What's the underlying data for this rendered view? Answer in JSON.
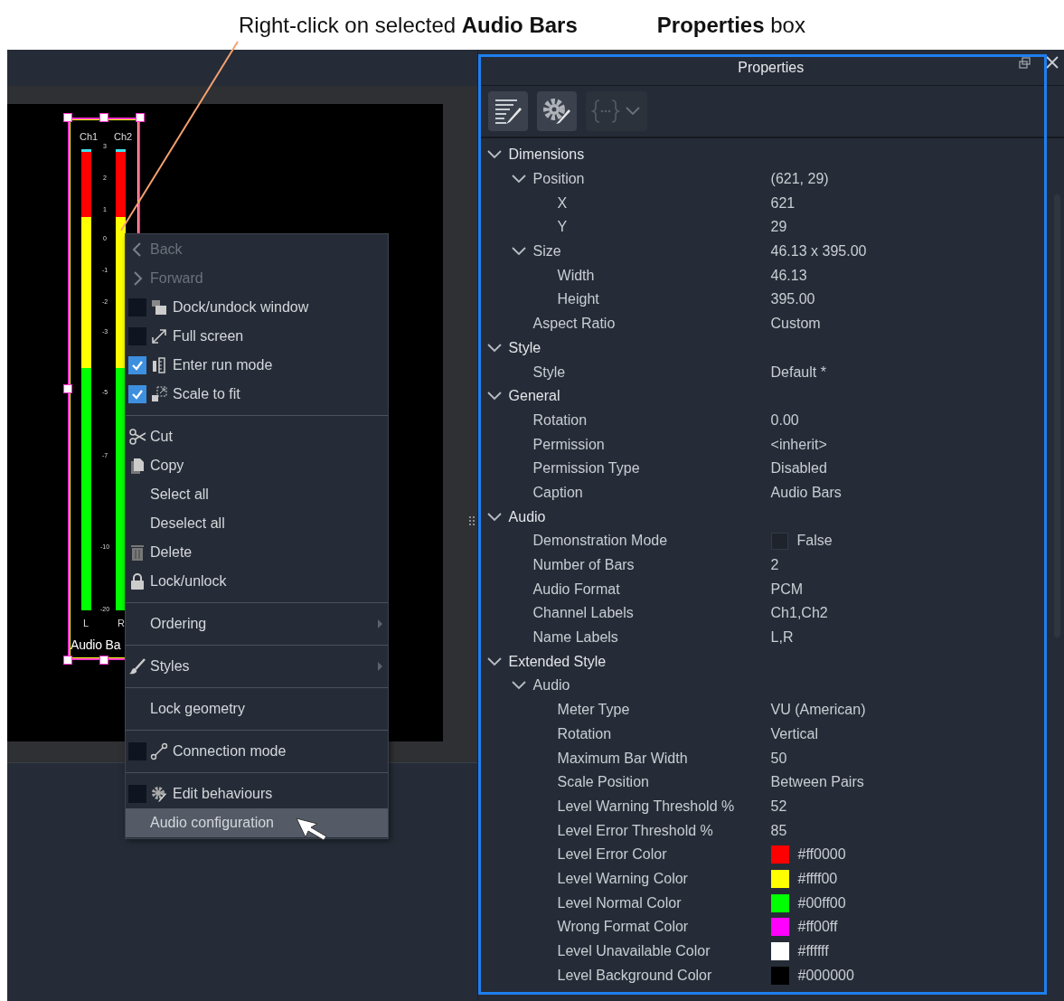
{
  "annotations": [
    {
      "text": "Right-click on selected **Audio Bars**"
    },
    {
      "text": "**Properties** box"
    }
  ],
  "audio_widget": {
    "channel_labels": [
      "Ch1",
      "Ch2"
    ],
    "scale_labels": [
      "3",
      "2",
      "1",
      "0",
      "-1",
      "-2",
      "-3",
      "-5",
      "-7",
      "-10",
      "-20"
    ],
    "name_labels": [
      "L",
      "R"
    ],
    "caption": "Audio Ba",
    "selected": true
  },
  "context_menu": {
    "sections": [
      [
        {
          "label": "Back",
          "kind": "nav",
          "disabled": true,
          "selected": false
        },
        {
          "label": "Forward",
          "kind": "nav",
          "disabled": true,
          "selected": false
        },
        {
          "label": "Dock/undock window",
          "kind": "check",
          "checked": false,
          "disabled": false,
          "selected": false
        },
        {
          "label": "Full screen",
          "kind": "check",
          "checked": false,
          "disabled": false,
          "selected": false
        },
        {
          "label": "Enter run mode",
          "kind": "check",
          "checked": true,
          "disabled": false,
          "selected": false
        },
        {
          "label": "Scale to fit",
          "kind": "check",
          "checked": true,
          "disabled": false,
          "selected": false
        }
      ],
      [
        {
          "label": "Cut",
          "kind": "action",
          "disabled": false,
          "selected": false
        },
        {
          "label": "Copy",
          "kind": "action",
          "disabled": false,
          "selected": false
        },
        {
          "label": "Select all",
          "kind": "action",
          "disabled": false,
          "selected": false
        },
        {
          "label": "Deselect all",
          "kind": "action",
          "disabled": false,
          "selected": false
        },
        {
          "label": "Delete",
          "kind": "action",
          "disabled": false,
          "selected": false
        },
        {
          "label": "Lock/unlock",
          "kind": "action",
          "disabled": false,
          "selected": false
        }
      ],
      [
        {
          "label": "Ordering",
          "kind": "submenu",
          "disabled": false,
          "selected": false
        }
      ],
      [
        {
          "label": "Styles",
          "kind": "submenu",
          "disabled": false,
          "selected": false
        }
      ],
      [
        {
          "label": "Lock geometry",
          "kind": "action",
          "disabled": false,
          "selected": false
        }
      ],
      [
        {
          "label": "Connection mode",
          "kind": "check",
          "checked": false,
          "disabled": false,
          "selected": false
        }
      ],
      [
        {
          "label": "Edit behaviours",
          "kind": "check",
          "checked": false,
          "disabled": false,
          "selected": false
        },
        {
          "label": "Audio configuration",
          "kind": "action",
          "disabled": false,
          "selected": true
        }
      ]
    ]
  },
  "properties": {
    "title": "Properties",
    "tree": [
      {
        "label": "Dimensions",
        "expanded": true,
        "children": [
          {
            "label": "Position",
            "value": "(621, 29)",
            "expanded": true,
            "children": [
              {
                "label": "X",
                "kind": "text",
                "value": "621"
              },
              {
                "label": "Y",
                "kind": "text",
                "value": "29"
              }
            ]
          },
          {
            "label": "Size",
            "value": "46.13 x 395.00",
            "expanded": true,
            "children": [
              {
                "label": "Width",
                "kind": "text",
                "value": "46.13"
              },
              {
                "label": "Height",
                "kind": "text",
                "value": "395.00"
              }
            ]
          },
          {
            "label": "Aspect Ratio",
            "kind": "text",
            "value": "Custom"
          }
        ]
      },
      {
        "label": "Style",
        "expanded": true,
        "children": [
          {
            "label": "Style",
            "kind": "text",
            "value": "Default *"
          }
        ]
      },
      {
        "label": "General",
        "expanded": true,
        "children": [
          {
            "label": "Rotation",
            "kind": "text",
            "value": "0.00"
          },
          {
            "label": "Permission",
            "kind": "text",
            "value": "<inherit>"
          },
          {
            "label": "Permission Type",
            "kind": "text",
            "value": "Disabled"
          },
          {
            "label": "Caption",
            "kind": "text",
            "value": "Audio Bars"
          }
        ]
      },
      {
        "label": "Audio",
        "expanded": true,
        "children": [
          {
            "label": "Demonstration Mode",
            "kind": "checkbox",
            "checked": false,
            "value": "False"
          },
          {
            "label": "Number of Bars",
            "kind": "text",
            "value": "2"
          },
          {
            "label": "Audio Format",
            "kind": "text",
            "value": "PCM"
          },
          {
            "label": "Channel Labels",
            "kind": "text",
            "value": "Ch1,Ch2"
          },
          {
            "label": "Name Labels",
            "kind": "text",
            "value": "L,R"
          }
        ]
      },
      {
        "label": "Extended Style",
        "expanded": true,
        "children": [
          {
            "label": "Audio",
            "expanded": true,
            "children": [
              {
                "label": "Meter Type",
                "kind": "text",
                "value": "VU (American)"
              },
              {
                "label": "Rotation",
                "kind": "text",
                "value": "Vertical"
              },
              {
                "label": "Maximum Bar Width",
                "kind": "text",
                "value": "50"
              },
              {
                "label": "Scale Position",
                "kind": "text",
                "value": "Between Pairs"
              },
              {
                "label": "Level Warning Threshold %",
                "kind": "text",
                "value": "52"
              },
              {
                "label": "Level Error Threshold %",
                "kind": "text",
                "value": "85"
              },
              {
                "label": "Level Error Color",
                "kind": "color",
                "color": "#ff0000",
                "value": "#ff0000"
              },
              {
                "label": "Level Warning Color",
                "kind": "color",
                "color": "#ffff00",
                "value": "#ffff00"
              },
              {
                "label": "Level Normal Color",
                "kind": "color",
                "color": "#00ff00",
                "value": "#00ff00"
              },
              {
                "label": "Wrong Format Color",
                "kind": "color",
                "color": "#ff00ff",
                "value": "#ff00ff"
              },
              {
                "label": "Level Unavailable Color",
                "kind": "color",
                "color": "#ffffff",
                "value": "#ffffff"
              },
              {
                "label": "Level Background Color",
                "kind": "color",
                "color": "#000000",
                "value": "#000000"
              }
            ]
          }
        ]
      }
    ]
  }
}
